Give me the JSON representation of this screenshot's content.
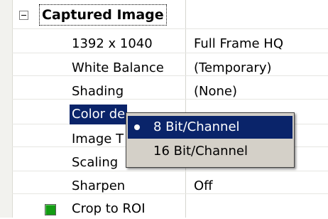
{
  "group": {
    "title": "Captured Image",
    "expanded": true,
    "expander_icon": "minus-box-icon"
  },
  "properties": [
    {
      "name": "1392 x 1040",
      "value": "Full Frame HQ"
    },
    {
      "name": "White Balance",
      "value": "(Temporary)"
    },
    {
      "name": "Shading",
      "value": "(None)"
    },
    {
      "name": "Color de",
      "value": ""
    },
    {
      "name": "Image T",
      "value": ""
    },
    {
      "name": "Scaling",
      "value": ""
    },
    {
      "name": "Sharpen",
      "value": "Off"
    },
    {
      "name": "Crop to ROI",
      "value": ""
    }
  ],
  "crop_color": "#139c13",
  "selection_color": "#0a246a",
  "dropdown": {
    "options": [
      {
        "label": "8 Bit/Channel",
        "selected": true,
        "icon": "radio-bullet-icon"
      },
      {
        "label": "16 Bit/Channel",
        "selected": false
      }
    ]
  }
}
